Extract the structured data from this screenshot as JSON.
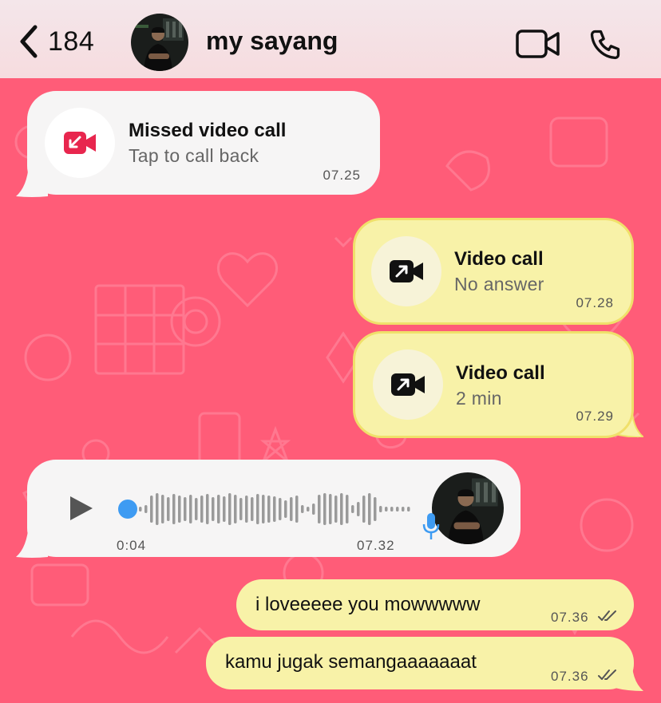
{
  "colors": {
    "background": "#ff5c78",
    "header_bg": "#f4e6ea",
    "incoming_bubble": "#f6f5f5",
    "outgoing_bubble": "#f8f2a8",
    "missed_icon": "#e8264e",
    "voice_accent": "#3e9bf2"
  },
  "header": {
    "back_count": "184",
    "contact_name": "my sayang",
    "icons": [
      "chevron-left-icon",
      "video-camera-icon",
      "phone-icon"
    ]
  },
  "messages": {
    "missed_call": {
      "title": "Missed video call",
      "subtitle": "Tap to call back",
      "time": "07.25",
      "icon": "missed-video-call-icon"
    },
    "video_call_1": {
      "title": "Video call",
      "subtitle": "No answer",
      "time": "07.28",
      "icon": "outgoing-video-call-icon"
    },
    "video_call_2": {
      "title": "Video call",
      "subtitle": "2 min",
      "time": "07.29",
      "icon": "outgoing-video-call-icon"
    },
    "voice_note": {
      "duration": "0:04",
      "time": "07.32",
      "progress": 0,
      "icons": [
        "play-icon",
        "microphone-icon"
      ]
    },
    "text_1": {
      "text": "i loveeeee you mowwwww",
      "time": "07.36",
      "status": "double-check-icon"
    },
    "text_2": {
      "text": "kamu jugak semangaaaaaaat",
      "time": "07.36",
      "status": "double-check-icon"
    }
  }
}
